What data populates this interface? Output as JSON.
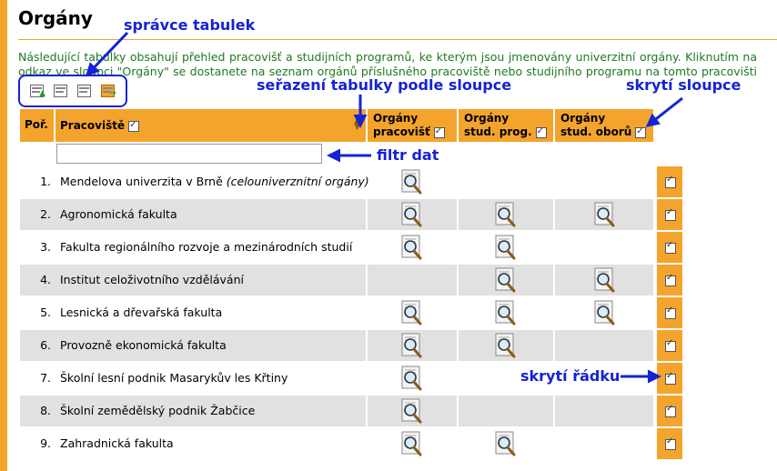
{
  "page": {
    "title": "Orgány",
    "intro": "Následující tabulky obsahují přehled pracovišť a studijních programů, ke kterým jsou jmenovány univerzitní orgány. Kliknutím na odkaz ve sloupci \"Orgány\" se dostanete na seznam orgánů příslušného pracoviště nebo studijního programu na tomto pracovišti (fakultě)."
  },
  "annotations": {
    "table_manager": "správce tabulek",
    "sort": "seřazení tabulky podle sloupce",
    "hide_column": "skrytí sloupce",
    "filter": "filtr dat",
    "hide_row": "skrytí řádku"
  },
  "table": {
    "headers": {
      "num": "Poř.",
      "workplace": "Pracoviště",
      "org_workplace_1": "Orgány",
      "org_workplace_2": "pracovišť",
      "org_prog_1": "Orgány",
      "org_prog_2": "stud. prog.",
      "org_field_1": "Orgány",
      "org_field_2": "stud. oborů"
    },
    "filter_value": "",
    "rows": [
      {
        "num": "1.",
        "name": "Mendelova univerzita v Brně",
        "note": "(celouniverznitní orgány)",
        "org": true,
        "prog": false,
        "field": false
      },
      {
        "num": "2.",
        "name": "Agronomická fakulta",
        "note": "",
        "org": true,
        "prog": true,
        "field": true
      },
      {
        "num": "3.",
        "name": "Fakulta regionálního rozvoje a mezinárodních studií",
        "note": "",
        "org": true,
        "prog": true,
        "field": false
      },
      {
        "num": "4.",
        "name": "Institut celoživotního vzdělávání",
        "note": "",
        "org": false,
        "prog": true,
        "field": true
      },
      {
        "num": "5.",
        "name": "Lesnická a dřevařská fakulta",
        "note": "",
        "org": true,
        "prog": true,
        "field": true
      },
      {
        "num": "6.",
        "name": "Provozně ekonomická fakulta",
        "note": "",
        "org": true,
        "prog": true,
        "field": false
      },
      {
        "num": "7.",
        "name": "Školní lesní podnik Masarykův les Křtiny",
        "note": "",
        "org": true,
        "prog": false,
        "field": false
      },
      {
        "num": "8.",
        "name": "Školní zemědělský podnik Žabčice",
        "note": "",
        "org": true,
        "prog": false,
        "field": false
      },
      {
        "num": "9.",
        "name": "Zahradnická fakulta",
        "note": "",
        "org": true,
        "prog": true,
        "field": false
      }
    ]
  },
  "colors": {
    "accent": "#f4a42c",
    "annotation": "#1423d6",
    "intro_text": "#1f7a1f",
    "row_alt": "#e1e1e1"
  },
  "icons": [
    "table-manager-icon-1",
    "table-manager-icon-2",
    "table-manager-icon-3",
    "export-icon",
    "magnifier-icon",
    "checkbox-icon",
    "sort-arrows-icon"
  ]
}
